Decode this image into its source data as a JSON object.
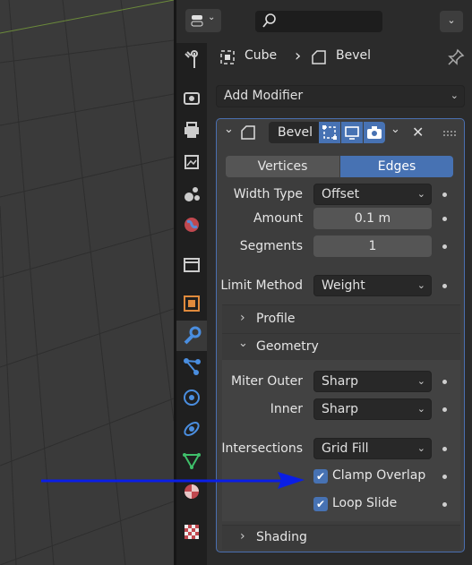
{
  "header": {
    "editor_type_icon": "properties-editor-icon",
    "search_placeholder": ""
  },
  "breadcrumb": {
    "object": "Cube",
    "separator": "›",
    "modifier": "Bevel"
  },
  "add_modifier": {
    "label": "Add Modifier"
  },
  "modifier": {
    "name": "Bevel",
    "mode_tabs": [
      "Vertices",
      "Edges"
    ],
    "active_tab": "Edges",
    "width_type": {
      "label": "Width Type",
      "value": "Offset"
    },
    "amount": {
      "label": "Amount",
      "value": "0.1 m"
    },
    "segments": {
      "label": "Segments",
      "value": "1"
    },
    "limit_method": {
      "label": "Limit Method",
      "value": "Weight"
    },
    "profile": {
      "label": "Profile"
    },
    "geometry": {
      "label": "Geometry",
      "miter_outer": {
        "label": "Miter Outer",
        "value": "Sharp"
      },
      "inner": {
        "label": "Inner",
        "value": "Sharp"
      },
      "intersections": {
        "label": "Intersections",
        "value": "Grid Fill"
      },
      "clamp_overlap": {
        "label": "Clamp Overlap",
        "checked": true
      },
      "loop_slide": {
        "label": "Loop Slide",
        "checked": true
      }
    },
    "shading": {
      "label": "Shading"
    }
  },
  "colors": {
    "accent": "#4772b3",
    "arrow": "#0a1ee6",
    "panel_bg": "#2b2b2b",
    "modifier_bg": "#3d3d3d",
    "viewport_bg": "#3a3a3a"
  }
}
